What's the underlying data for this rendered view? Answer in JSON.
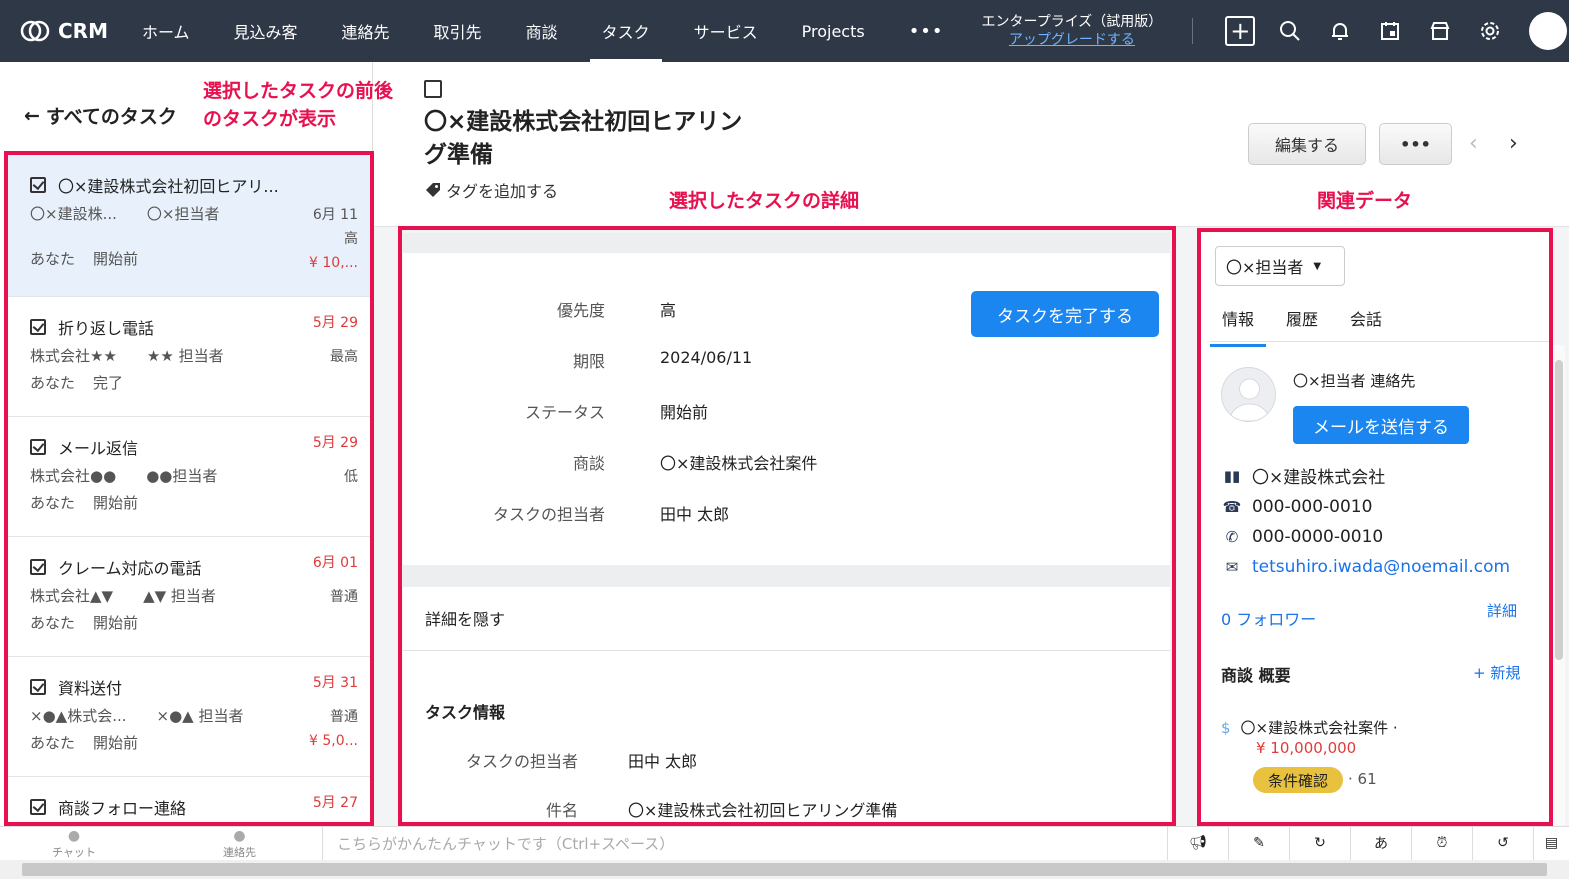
{
  "topbar": {
    "app_name": "CRM",
    "nav": [
      "ホーム",
      "見込み客",
      "連絡先",
      "取引先",
      "商談",
      "タスク",
      "サービス",
      "Projects"
    ],
    "more": "•••",
    "trial_label": "エンタープライズ（試用版）",
    "upgrade_link": "アップグレードする"
  },
  "annotations": {
    "nav_note_line1": "選択したタスクの前後",
    "nav_note_line2": "のタスクが表示",
    "detail_note": "選択したタスクの詳細",
    "related_note": "関連データ"
  },
  "left": {
    "back": "すべてのタスク",
    "tasks": [
      {
        "title": "〇×建設株式会社初回ヒアリ...",
        "account": "〇×建設株...",
        "owner": "〇×担当者",
        "date": "6月 11",
        "priority": "高",
        "assignee": "あなた",
        "status": "開始前",
        "amount": "¥ 10,..."
      },
      {
        "title": "折り返し電話",
        "account": "株式会社★★",
        "owner": "★★ 担当者",
        "date": "5月 29",
        "priority": "最高",
        "assignee": "あなた",
        "status": "完了",
        "amount": ""
      },
      {
        "title": "メール返信",
        "account": "株式会社●●",
        "owner": "●●担当者",
        "date": "5月 29",
        "priority": "低",
        "assignee": "あなた",
        "status": "開始前",
        "amount": ""
      },
      {
        "title": "クレーム対応の電話",
        "account": "株式会社▲▼",
        "owner": "▲▼ 担当者",
        "date": "6月 01",
        "priority": "普通",
        "assignee": "あなた",
        "status": "開始前",
        "amount": ""
      },
      {
        "title": "資料送付",
        "account": "×●▲株式会...",
        "owner": "×●▲ 担当者",
        "date": "5月 31",
        "priority": "普通",
        "assignee": "あなた",
        "status": "開始前",
        "amount": "¥ 5,0..."
      },
      {
        "title": "商談フォロー連絡",
        "account": "",
        "owner": "",
        "date": "5月 27",
        "priority": "",
        "assignee": "",
        "status": "",
        "amount": ""
      }
    ]
  },
  "header": {
    "title": "〇×建設株式会社初回ヒアリング準備",
    "add_tag": "タグを追加する",
    "edit": "編集する",
    "more": "•••"
  },
  "detail": {
    "fields": [
      {
        "label": "優先度",
        "value": "高"
      },
      {
        "label": "期限",
        "value": "2024/06/11"
      },
      {
        "label": "ステータス",
        "value": "開始前"
      },
      {
        "label": "商談",
        "value": "〇×建設株式会社案件"
      },
      {
        "label": "タスクの担当者",
        "value": "田中 太郎"
      }
    ],
    "complete_button": "タスクを完了する",
    "hide_details": "詳細を隠す",
    "section_title": "タスク情報",
    "info_fields": [
      {
        "label": "タスクの担当者",
        "value": "田中 太郎"
      },
      {
        "label": "件名",
        "value": "〇×建設株式会社初回ヒアリング準備"
      }
    ]
  },
  "related": {
    "contact_select": "〇×担当者",
    "tabs": [
      "情報",
      "履歴",
      "会話"
    ],
    "contact_name": "〇×担当者 連絡先",
    "send_mail": "メールを送信する",
    "company": "〇×建設株式会社",
    "phone": "000-000-0010",
    "mobile": "000-0000-0010",
    "email": "tetsuhiro.iwada@noemail.com",
    "followers": "0 フォロワー",
    "details": "詳細",
    "deals_title": "商談 概要",
    "new": "+ 新規",
    "deal_name": "〇×建設株式会社案件 ·",
    "deal_amount": "¥ 10,000,000",
    "deal_stage": "条件確認",
    "deal_suffix": "· 61"
  },
  "bottombar": {
    "chat": "チャット",
    "contacts": "連絡先",
    "chat_placeholder": "こちらがかんたんチャットです（Ctrl+スペース）"
  }
}
